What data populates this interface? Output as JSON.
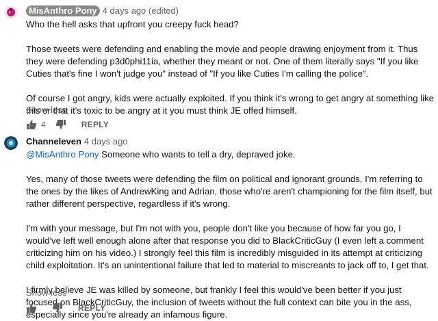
{
  "comments": [
    {
      "author": "MisAnthro Pony",
      "meta": "4 days ago (edited)",
      "paragraphs": [
        "Who the hell asks that upfront you creepy fuck head?",
        "Those tweets were defending and enabling the movie and people drawing enjoyment from it. Thus they were defending p3d0phi11ia, whether they meant or not. One of them literally says \"If you like Cuties that's fine I won't judge you\" instead of \"If you like Cuties I'm calling the police\".",
        "Of course I got angry, kids were actually exploited. If you think it's wrong to get angry at something like this or that it's toxic to be angry at it you must think JE offed himself."
      ],
      "show_less": "Show less",
      "like_count": "4",
      "reply": "REPLY",
      "avatar_color": "#c41c6a"
    },
    {
      "author": "Channeleven",
      "meta": "4 days ago",
      "mention": "@MisAnthro Pony",
      "first_line_rest": " Someone who wants to tell a dry, depraved joke.",
      "paragraphs": [
        "Yes, many of those tweets were defending the film on political and ignorant grounds, I'm referring to the ones by the likes of AndrewKing and Adrian, those who're aren't championing for the film itself, but rather different perspective, regardless if it's wrong.",
        "I'm with your message, but I'm not with you, people don't like you because of how far you go, I would've left well enough alone after that response you did to BlackCriticGuy (I even left a comment criticizing him on his video.) I strongly feel this film is incredibly misguided in its attempt at criticizing child exploitation. It's an unintentional failure that led to material to miscreants to jack off to, I get that.",
        "I firmly believe JE was killed by someone, but frankly I feel this would've been better if you just focused on BlackCriticGuy, the inclusion of tweets without the full context can bite you in the ass, especially since you're already an infamous figure."
      ],
      "show_less": "Show less",
      "reply": "REPLY",
      "avatar_color": "#2a8aa8"
    }
  ],
  "icons": {
    "like": "thumbs-up-icon",
    "dislike": "thumbs-down-icon"
  }
}
